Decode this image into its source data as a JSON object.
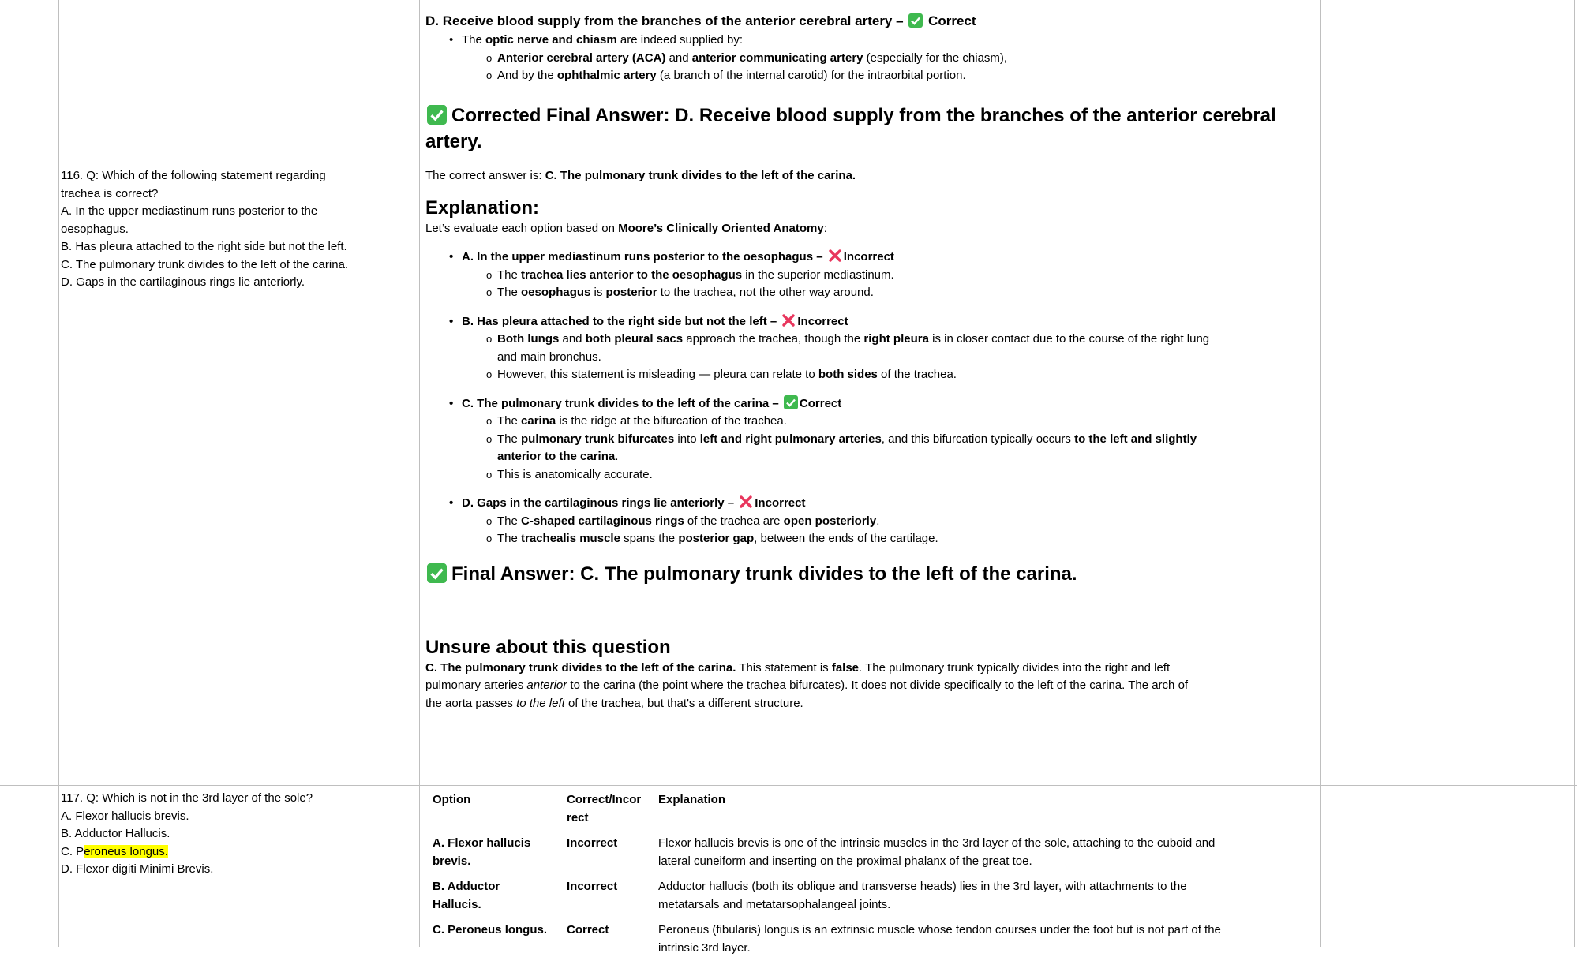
{
  "row_top": {
    "d_option": "D. Receive blood supply from the branches of the anterior cerebral artery –",
    "d_status": "Correct",
    "bullet_pre": "The ",
    "bullet_bold": "optic nerve and chiasm",
    "bullet_post": " are indeed supplied by:",
    "sub1_b1": "Anterior cerebral artery (ACA)",
    "sub1_t1": " and ",
    "sub1_b2": "anterior communicating artery",
    "sub1_t2": " (especially for the chiasm),",
    "sub2_t1": "And by the ",
    "sub2_b1": "ophthalmic artery",
    "sub2_t2": " (a branch of the internal carotid) for the intraorbital portion.",
    "final_line1": "Corrected Final Answer: D. Receive blood supply from the branches of the anterior cerebral",
    "final_line2": "artery."
  },
  "q116": {
    "question_lines": [
      "116. Q: Which of the following statement regarding",
      "trachea is correct?",
      "A. In the upper mediastinum runs posterior to the",
      "oesophagus.",
      "B. Has pleura attached to the right side but not the left.",
      "C. The pulmonary trunk divides to the left of the carina.",
      "D. Gaps in the cartilaginous rings lie anteriorly."
    ],
    "correct_pre": "The correct answer is: ",
    "correct_bold": "C. The pulmonary trunk divides to the left of the carina.",
    "explanation_heading": "Explanation:",
    "eval_pre": "Let’s evaluate each option based on ",
    "eval_bold": "Moore’s Clinically Oriented Anatomy",
    "eval_post": ":",
    "optA": "A. In the upper mediastinum runs posterior to the oesophagus –",
    "optA_status": "Incorrect",
    "optA_s1_t1": "The ",
    "optA_s1_b1": "trachea lies anterior to the oesophagus",
    "optA_s1_t2": " in the superior mediastinum.",
    "optA_s2_t1": "The ",
    "optA_s2_b1": "oesophagus",
    "optA_s2_t2": " is ",
    "optA_s2_b2": "posterior",
    "optA_s2_t3": " to the trachea, not the other way around.",
    "optB": "B. Has pleura attached to the right side but not the left –",
    "optB_status": "Incorrect",
    "optB_s1_b1": "Both lungs",
    "optB_s1_t1": " and ",
    "optB_s1_b2": "both pleural sacs",
    "optB_s1_t2": " approach the trachea, though the ",
    "optB_s1_b3": "right pleura",
    "optB_s1_t3": " is in closer contact due to the course of the right lung",
    "optB_s1_t4": "and main bronchus.",
    "optB_s2_t1": "However, this statement is misleading — pleura can relate to ",
    "optB_s2_b1": "both sides",
    "optB_s2_t2": " of the trachea.",
    "optC": "C. The pulmonary trunk divides to the left of the carina –",
    "optC_status": "Correct",
    "optC_s1_t1": "The ",
    "optC_s1_b1": "carina",
    "optC_s1_t2": " is the ridge at the bifurcation of the trachea.",
    "optC_s2_t1": "The ",
    "optC_s2_b1": "pulmonary trunk bifurcates",
    "optC_s2_t2": " into ",
    "optC_s2_b2": "left and right pulmonary arteries",
    "optC_s2_t3": ", and this bifurcation typically occurs ",
    "optC_s2_b3": "to the left and slightly",
    "optC_s2_b4": "anterior to the carina",
    "optC_s2_t4": ".",
    "optC_s3": "This is anatomically accurate.",
    "optD": "D. Gaps in the cartilaginous rings lie anteriorly –",
    "optD_status": "Incorrect",
    "optD_s1_t1": "The ",
    "optD_s1_b1": "C-shaped cartilaginous rings",
    "optD_s1_t2": " of the trachea are ",
    "optD_s1_b2": "open posteriorly",
    "optD_s1_t3": ".",
    "optD_s2_t1": "The ",
    "optD_s2_b1": "trachealis muscle",
    "optD_s2_t2": " spans the ",
    "optD_s2_b2": "posterior gap",
    "optD_s2_t3": ", between the ends of the cartilage.",
    "final_answer": "Final Answer: C. The pulmonary trunk divides to the left of the carina.",
    "unsure_heading": "Unsure about this question",
    "unsure_b1": "C. The pulmonary trunk divides to the left of the carina.",
    "unsure_t1": " This statement is ",
    "unsure_b2": "false",
    "unsure_t2": ". The pulmonary trunk typically divides into the right and left",
    "unsure_t3": "pulmonary arteries ",
    "unsure_i1": "anterior",
    "unsure_t4": " to the carina (the point where the trachea bifurcates). It does not divide specifically to the left of the carina. The arch of",
    "unsure_t5": "the aorta passes ",
    "unsure_i2": "to the left",
    "unsure_t6": " of the trachea, but that's a different structure."
  },
  "q117": {
    "line1": "117. Q: Which is not in the 3rd layer of the sole?",
    "line2": "A. Flexor hallucis brevis.",
    "line3": "B. Adductor  Hallucis.",
    "line4_pre": "C. P",
    "line4_hl": "eroneus longus.",
    "line5": "D. Flexor digiti Minimi Brevis.",
    "table": {
      "headers": [
        "Option",
        "Correct/Incor",
        "rect",
        "Explanation"
      ],
      "rows": [
        {
          "option_l1": "A. Flexor hallucis",
          "option_l2": "brevis.",
          "status": "Incorrect",
          "exp_l1": "Flexor hallucis brevis is one of the intrinsic muscles in the 3rd layer of the sole, attaching to the cuboid and",
          "exp_l2": "lateral cuneiform and inserting on the proximal phalanx of the great toe."
        },
        {
          "option_l1": "B. Adductor",
          "option_l2": "Hallucis.",
          "status": "Incorrect",
          "exp_l1": "Adductor hallucis (both its oblique and transverse heads) lies in the 3rd layer, with attachments to the",
          "exp_l2": "metatarsals and metatarsophalangeal joints."
        },
        {
          "option_l1": "C. Peroneus longus.",
          "option_l2": "",
          "status": "Correct",
          "exp_l1": "Peroneus (fibularis) longus is an extrinsic muscle whose tendon courses under the foot but is not part of the",
          "exp_l2": "intrinsic 3rd layer."
        }
      ]
    }
  },
  "icons": {
    "check": "check-box-icon",
    "cross": "cross-icon",
    "check_color": "#3fb94f",
    "cross_color": "#e8365d",
    "highlight_color": "#ffff00",
    "grid_color": "#bfbfbf"
  }
}
